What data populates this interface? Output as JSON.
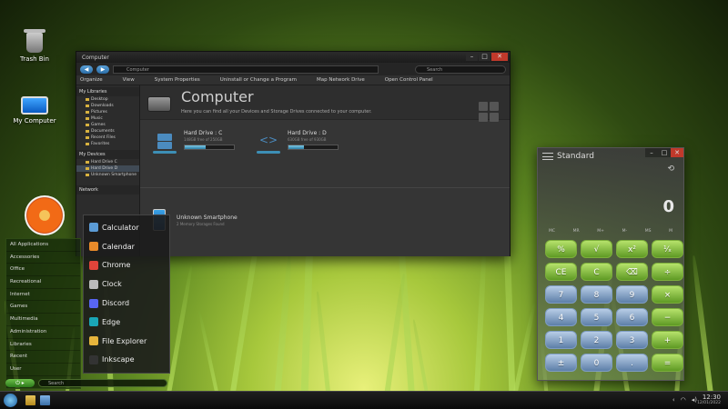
{
  "desktop": {
    "icons": [
      {
        "label": "Trash Bin"
      },
      {
        "label": "My Computer"
      }
    ]
  },
  "explorer": {
    "title": "Computer",
    "address": "Computer",
    "search_placeholder": "Search",
    "commands": [
      "Organize",
      "View",
      "System Properties",
      "Uninstall or Change a Program",
      "Map Network Drive",
      "Open Control Panel"
    ],
    "nav": {
      "libraries_header": "My Libraries",
      "libraries": [
        "Desktop",
        "Downloads",
        "Pictures",
        "Music",
        "Games",
        "Documents",
        "Recent Files",
        "Favorites"
      ],
      "devices_header": "My Devices",
      "devices": [
        "Hard Drive C",
        "Hard Drive D",
        "Unknown Smartphone"
      ],
      "network_header": "Network"
    },
    "heading": "Computer",
    "subheading": "Here you can find all your Devices and Storage Drives connected to your computer.",
    "drives": [
      {
        "name": "Hard Drive : C",
        "meta": "148GB free of 250GB",
        "usage": 0.42
      },
      {
        "name": "Hard Drive : D",
        "meta": "630GB free of 930GB",
        "usage": 0.32
      }
    ],
    "device": {
      "name": "Unknown Smartphone",
      "meta": "2 Memory Storages Found"
    }
  },
  "startmenu": {
    "categories": [
      "All Applications",
      "Accessories",
      "Office",
      "Recreational",
      "Internet",
      "Games",
      "Multimedia",
      "Administration",
      "Libraries",
      "Recent",
      "User"
    ],
    "apps": [
      {
        "label": "Calculator",
        "color": "#5b9bd5"
      },
      {
        "label": "Calendar",
        "color": "#e88a2a"
      },
      {
        "label": "Chrome",
        "color": "#e0443a"
      },
      {
        "label": "Clock",
        "color": "#bbbbbb"
      },
      {
        "label": "Discord",
        "color": "#5865f2"
      },
      {
        "label": "Edge",
        "color": "#1aa6b7"
      },
      {
        "label": "File Explorer",
        "color": "#e6b43c"
      },
      {
        "label": "Inkscape",
        "color": "#333333"
      }
    ],
    "search_placeholder": "Search"
  },
  "calculator": {
    "title": "Standard",
    "display": "0",
    "memory": [
      "MC",
      "MR",
      "M+",
      "M-",
      "MS",
      "M"
    ],
    "keys": [
      {
        "label": "%",
        "style": "g"
      },
      {
        "label": "√",
        "style": "g"
      },
      {
        "label": "x²",
        "style": "g"
      },
      {
        "label": "¹⁄ₓ",
        "style": "g"
      },
      {
        "label": "CE",
        "style": "g"
      },
      {
        "label": "C",
        "style": "g"
      },
      {
        "label": "⌫",
        "style": "g"
      },
      {
        "label": "÷",
        "style": "g"
      },
      {
        "label": "7",
        "style": "b"
      },
      {
        "label": "8",
        "style": "b"
      },
      {
        "label": "9",
        "style": "b"
      },
      {
        "label": "×",
        "style": "g"
      },
      {
        "label": "4",
        "style": "b"
      },
      {
        "label": "5",
        "style": "b"
      },
      {
        "label": "6",
        "style": "b"
      },
      {
        "label": "−",
        "style": "g"
      },
      {
        "label": "1",
        "style": "b"
      },
      {
        "label": "2",
        "style": "b"
      },
      {
        "label": "3",
        "style": "b"
      },
      {
        "label": "+",
        "style": "g"
      },
      {
        "label": "±",
        "style": "b"
      },
      {
        "label": "0",
        "style": "b"
      },
      {
        "label": ".",
        "style": "b"
      },
      {
        "label": "=",
        "style": "g"
      }
    ]
  },
  "taskbar": {
    "time": "12:30",
    "date": "12/01/2022"
  }
}
